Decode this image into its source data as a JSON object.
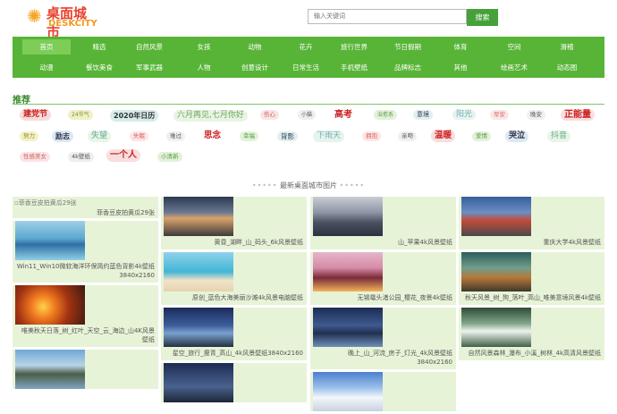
{
  "logo": {
    "line1": "桌面城市",
    "line2": "DESKCITY"
  },
  "search": {
    "placeholder": "输入关键词",
    "button": "搜索"
  },
  "nav_row1": [
    "首页",
    "精选",
    "自然风景",
    "女孩",
    "动物",
    "花卉",
    "旅行世界",
    "节日假期",
    "体育",
    "空间",
    "滑稽"
  ],
  "nav_row2": [
    "动漫",
    "餐饮美食",
    "军事武器",
    "人物",
    "创意设计",
    "日常生活",
    "手机壁纸",
    "品牌标志",
    "其他",
    "绘画艺术",
    "动态图"
  ],
  "recommend_title": "推荐",
  "tags": [
    {
      "text": "建党节",
      "bg": "#f6dcdc",
      "color": "#c22",
      "bold": true
    },
    {
      "text": "24节气",
      "bg": "#eef0c8",
      "color": "#8a8a2a"
    },
    {
      "text": "2020年日历",
      "bg": "#d5ece9",
      "color": "#333",
      "bold": true
    },
    {
      "text": "六月再见,七月你好",
      "bg": "#e9f4e4",
      "color": "#6aa85a"
    },
    {
      "text": "伤心",
      "bg": "#fbe3e8",
      "color": "#c65"
    },
    {
      "text": "小猫",
      "bg": "#eeeeee",
      "color": "#555"
    },
    {
      "text": "高考",
      "bg": "#ffffff",
      "color": "#c22",
      "bold": true
    },
    {
      "text": "治愈系",
      "bg": "#e2f2d8",
      "color": "#5a9a4a"
    },
    {
      "text": "意境",
      "bg": "#dff0ee",
      "color": "#335"
    },
    {
      "text": "阳光",
      "bg": "#e5f4ec",
      "color": "#7ab"
    },
    {
      "text": "早安",
      "bg": "#fbe6e6",
      "color": "#d66"
    },
    {
      "text": "晚安",
      "bg": "#f0f0f0",
      "color": "#555"
    },
    {
      "text": "正能量",
      "bg": "#f8dede",
      "color": "#c22",
      "bold": true
    },
    {
      "text": "努力",
      "bg": "#f2f2c8",
      "color": "#9a8a2a"
    },
    {
      "text": "励志",
      "bg": "#dce9ef",
      "color": "#335",
      "bold": true
    },
    {
      "text": "失望",
      "bg": "#e9f5e5",
      "color": "#6a9"
    },
    {
      "text": "失眠",
      "bg": "#fde6e6",
      "color": "#d66"
    },
    {
      "text": "难过",
      "bg": "#f0f0f0",
      "color": "#555"
    },
    {
      "text": "思念",
      "bg": "#ffffff",
      "color": "#c22",
      "bold": true
    },
    {
      "text": "幸福",
      "bg": "#e2f2d8",
      "color": "#5a9a4a"
    },
    {
      "text": "背影",
      "bg": "#dff0ee",
      "color": "#335"
    },
    {
      "text": "下雨天",
      "bg": "#e5f4ec",
      "color": "#7ab"
    },
    {
      "text": "拥抱",
      "bg": "#fbe6e6",
      "color": "#d66"
    },
    {
      "text": "亲吻",
      "bg": "#f0f0f0",
      "color": "#555"
    },
    {
      "text": "温暖",
      "bg": "#f8dede",
      "color": "#c22",
      "bold": true
    },
    {
      "text": "爱情",
      "bg": "#e2f2d8",
      "color": "#5a9a4a"
    },
    {
      "text": "哭泣",
      "bg": "#dce9ef",
      "color": "#335",
      "bold": true
    },
    {
      "text": "抖音",
      "bg": "#e9f5e5",
      "color": "#6a9"
    },
    {
      "text": "性感美女",
      "bg": "#fbe3e8",
      "color": "#c65"
    },
    {
      "text": "4k壁纸",
      "bg": "#eeeeee",
      "color": "#555"
    },
    {
      "text": "一个人",
      "bg": "#f8dede",
      "color": "#c22",
      "bold": true
    },
    {
      "text": "小清新",
      "bg": "#e2f2d8",
      "color": "#5a9a4a"
    }
  ],
  "latest_title": "最新桌面城市图片",
  "columns": [
    [
      {
        "alt": "菲香豆皮拍黄瓜29张",
        "caption": "菲香豆皮拍黄瓜29张",
        "broken": true
      },
      {
        "caption": "Win11_Win10微软海洋环保简约蓝色背影4k壁纸3840x2160",
        "img": "ocean"
      },
      {
        "caption": "唯美秋天日落_树_红叶_天空_云_海边_山4K风景壁纸",
        "img": "sunset"
      },
      {
        "caption": "",
        "img": "lake"
      }
    ],
    [
      {
        "caption": "黄昏_湖畔_山_码头_6k风景壁纸",
        "img": "dock"
      },
      {
        "caption": "原创_蓝色大海美丽沙滩4k风景电脑壁纸",
        "img": "beach"
      },
      {
        "caption": "星空_旅行_瘦青_高山_4k风景壁纸3840x2160",
        "img": "stars"
      },
      {
        "caption": "",
        "img": "night"
      }
    ],
    [
      {
        "caption": "山_苹果4k风景壁纸",
        "img": "mountain"
      },
      {
        "caption": "无锡鼋头渚公园_樱花_夜景4k壁纸",
        "img": "sakura"
      },
      {
        "caption": "晚上_山_河流_房子_灯光_4k风景壁纸3840x2160",
        "img": "river"
      },
      {
        "caption": "",
        "img": "snow"
      }
    ],
    [
      {
        "caption": "重庆大学4k风景壁纸",
        "img": "campus"
      },
      {
        "caption": "秋天风景_树_狗_落叶_高山_唯美意境风景4k壁纸",
        "img": "valley"
      },
      {
        "caption": "自然风景森林_瀑布_小溪_树林_4k高清风景壁纸",
        "img": "waterfall"
      }
    ]
  ]
}
